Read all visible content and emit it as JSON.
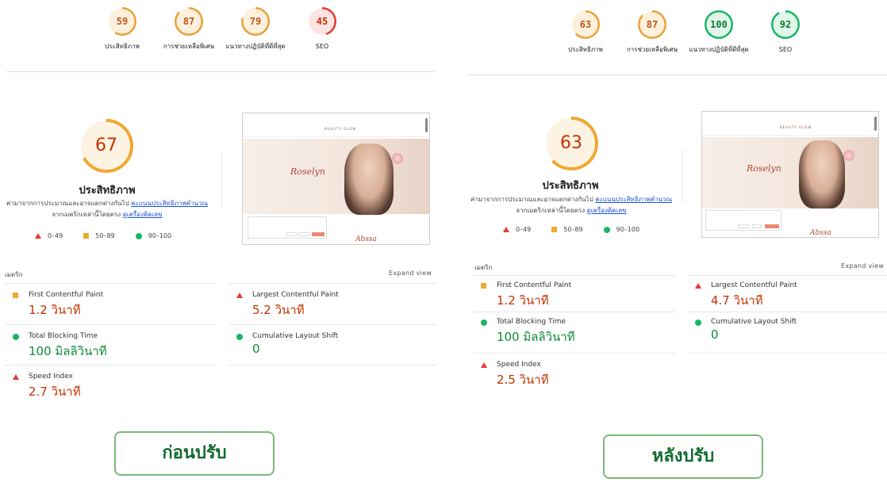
{
  "before": {
    "gauges": [
      {
        "value": "59",
        "score": 59,
        "label": "ประสิทธิภาพ",
        "color": "#e8a13a",
        "bg": "#fdf0dc",
        "text_color": "#c0561e"
      },
      {
        "value": "87",
        "score": 87,
        "label": "การช่วยเหลือพิเศษ",
        "color": "#e8a13a",
        "bg": "#fdf0dc",
        "text_color": "#c0561e"
      },
      {
        "value": "79",
        "score": 79,
        "label": "แนวทางปฏิบัติที่ดีที่สุด",
        "color": "#e8a13a",
        "bg": "#fdf0dc",
        "text_color": "#c0561e"
      },
      {
        "value": "45",
        "score": 45,
        "label": "SEO",
        "color": "#e53935",
        "bg": "#fde3e1",
        "text_color": "#c33300"
      }
    ],
    "performance": {
      "value": "67",
      "score": 67,
      "title": "ประสิทธิภาพ",
      "desc_text": "ค่ามาจากการประมาณและอาจแตกต่างกันไป",
      "desc_link": "คะแนนประสิทธิภาพคำนวณ",
      "desc_text2": "จากเมตริกเหล่านี้โดยตรง",
      "desc_link2": "ดูเครื่องคิดเลข"
    },
    "metrics_label": "เมตริก",
    "expand_label": "Expand view",
    "metrics": [
      {
        "name": "First Contentful Paint",
        "value": "1.2 วินาที",
        "status": "average"
      },
      {
        "name": "Largest Contentful Paint",
        "value": "5.2 วินาที",
        "status": "fail"
      },
      {
        "name": "Total Blocking Time",
        "value": "100 มิลลิวินาที",
        "status": "pass"
      },
      {
        "name": "Cumulative Layout Shift",
        "value": "0",
        "status": "pass"
      },
      {
        "name": "Speed Index",
        "value": "2.7 วินาที",
        "status": "fail"
      }
    ],
    "caption": "ก่อนปรับ"
  },
  "after": {
    "gauges": [
      {
        "value": "63",
        "score": 63,
        "label": "ประสิทธิภาพ",
        "color": "#e8a13a",
        "bg": "#fdf0dc",
        "text_color": "#c0561e"
      },
      {
        "value": "87",
        "score": 87,
        "label": "การช่วยเหลือพิเศษ",
        "color": "#e8a13a",
        "bg": "#fdf0dc",
        "text_color": "#c0561e"
      },
      {
        "value": "100",
        "score": 100,
        "label": "แนวทางปฏิบัติที่ดีที่สุด",
        "color": "#18b663",
        "bg": "#e1f6ea",
        "text_color": "#0d7a36"
      },
      {
        "value": "92",
        "score": 92,
        "label": "SEO",
        "color": "#18b663",
        "bg": "#e1f6ea",
        "text_color": "#0d7a36"
      }
    ],
    "performance": {
      "value": "63",
      "score": 63,
      "title": "ประสิทธิภาพ",
      "desc_text": "ค่ามาจากการประมาณและอาจแตกต่างกันไป",
      "desc_link": "คะแนนประสิทธิภาพคำนวณ",
      "desc_text2": "จากเมตริกเหล่านี้โดยตรง",
      "desc_link2": "ดูเครื่องคิดเลข"
    },
    "metrics_label": "เมตริก",
    "expand_label": "Expand view",
    "metrics": [
      {
        "name": "First Contentful Paint",
        "value": "1.2 วินาที",
        "status": "average"
      },
      {
        "name": "Largest Contentful Paint",
        "value": "4.7 วินาที",
        "status": "fail"
      },
      {
        "name": "Total Blocking Time",
        "value": "100 มิลลิวินาที",
        "status": "pass"
      },
      {
        "name": "Cumulative Layout Shift",
        "value": "0",
        "status": "pass"
      },
      {
        "name": "Speed Index",
        "value": "2.5 วินาที",
        "status": "fail"
      }
    ],
    "caption": "หลังปรับ"
  },
  "legend": {
    "fail": "0–49",
    "average": "50–89",
    "pass": "90–100"
  },
  "thumbnail": {
    "brand": "BEAUTY GLOW",
    "hero_name": "Roselyn",
    "tail_name": "Abssa"
  },
  "colors": {
    "fail": "#e53935",
    "average": "#f0a830",
    "pass": "#18b663",
    "big_gauge": "#f0a830"
  }
}
